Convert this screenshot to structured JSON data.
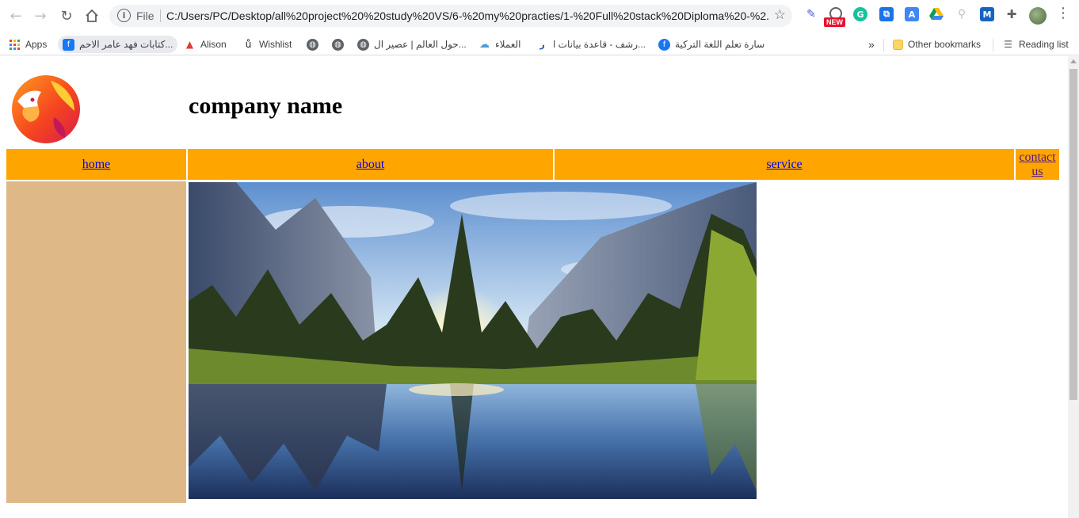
{
  "browser": {
    "back_icon": "arrow-left-icon",
    "forward_icon": "arrow-right-icon",
    "reload_icon": "reload-icon",
    "home_icon": "home-icon",
    "scheme_label": "File",
    "url": "C:/Users/PC/Desktop/all%20project%20%20study%20VS/6-%20my%20practies/1-%20Full%20stack%20Diploma%20-%2...",
    "extension_badge": "NEW"
  },
  "bookmarks": {
    "apps_label": "Apps",
    "items": [
      "كتابات فهد عامر الاحم...",
      "Alison",
      "Wishlist",
      "حول العالم | عصير ال...",
      "العملاء",
      "رشف - قاعدة بيانات ا...",
      "سارة تعلم اللغة التركية"
    ],
    "overflow_label": "»",
    "other_label": "Other bookmarks",
    "reading_label": "Reading list"
  },
  "page": {
    "company_name": "company name",
    "nav": {
      "home": "home",
      "about": "about",
      "service": "service",
      "contact": "contact us"
    }
  },
  "colors": {
    "nav_bg": "#ffa500",
    "sidebar_bg": "#deb887",
    "link": "#0000ee",
    "visited_link": "#551a8b"
  }
}
